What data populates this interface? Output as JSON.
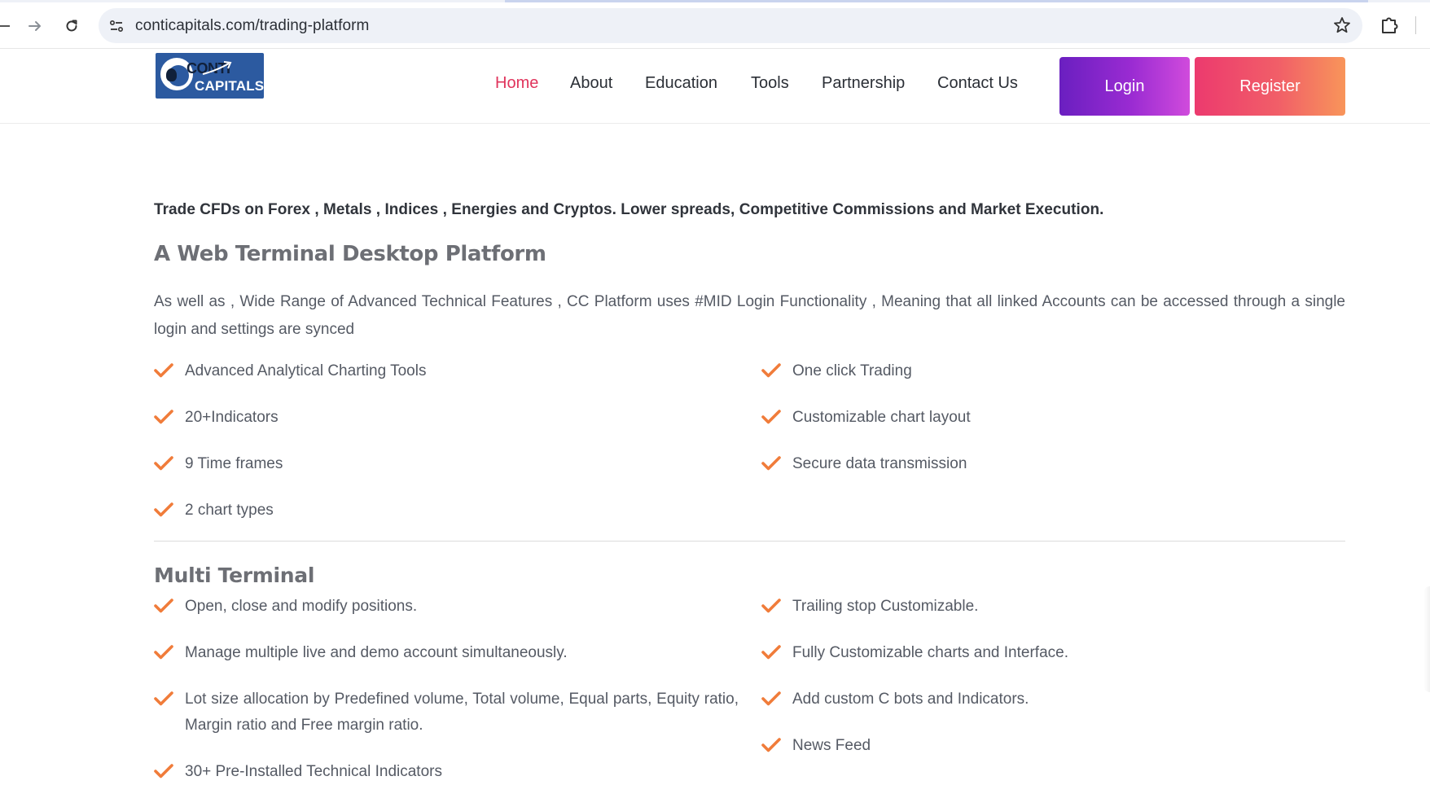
{
  "browser": {
    "url": "conticapitals.com/trading-platform",
    "back_icon": "back-arrow-icon",
    "forward_icon": "forward-arrow-icon",
    "reload_icon": "reload-icon",
    "bookmark_icon": "star-icon",
    "extensions_icon": "puzzle-icon"
  },
  "header": {
    "logo": {
      "top": "CONTI",
      "bottom": "CAPITALS"
    },
    "nav": [
      {
        "label": "Home",
        "active": true
      },
      {
        "label": "About",
        "active": false
      },
      {
        "label": "Education",
        "active": false
      },
      {
        "label": "Tools",
        "active": false
      },
      {
        "label": "Partnership",
        "active": false
      },
      {
        "label": "Contact Us",
        "active": false
      }
    ],
    "login_label": "Login",
    "register_label": "Register"
  },
  "content": {
    "intro": "Trade CFDs on Forex , Metals , Indices , Energies and Cryptos. Lower spreads, Competitive Commissions and Market Execution.",
    "web_terminal": {
      "heading": "A Web Terminal Desktop Platform",
      "description": "As well as , Wide Range of Advanced Technical Features , CC Platform uses #MID Login Functionality , Meaning that all linked Accounts can be accessed through a single login and settings are synced",
      "features_left": [
        "Advanced Analytical Charting Tools",
        "20+Indicators",
        "9 Time frames",
        "2 chart types"
      ],
      "features_right": [
        "One click Trading",
        "Customizable chart layout",
        "Secure data transmission"
      ]
    },
    "multi_terminal": {
      "heading": "Multi Terminal",
      "features_left": [
        "Open, close and modify positions.",
        "Manage multiple live and demo account simultaneously.",
        "Lot size allocation by Predefined volume, Total volume, Equal parts, Equity ratio, Margin ratio and Free margin ratio.",
        "30+ Pre-Installed Technical Indicators"
      ],
      "features_right": [
        "Trailing stop Customizable.",
        "Fully Customizable charts and Interface.",
        "Add custom C bots and Indicators.",
        "News Feed"
      ]
    }
  },
  "colors": {
    "accent_check": "#f07c3a",
    "nav_active": "#e0345c",
    "login_gradient": [
      "#6a1fc0",
      "#d04bdc"
    ],
    "register_gradient": [
      "#ec3a6e",
      "#f8955a"
    ]
  }
}
